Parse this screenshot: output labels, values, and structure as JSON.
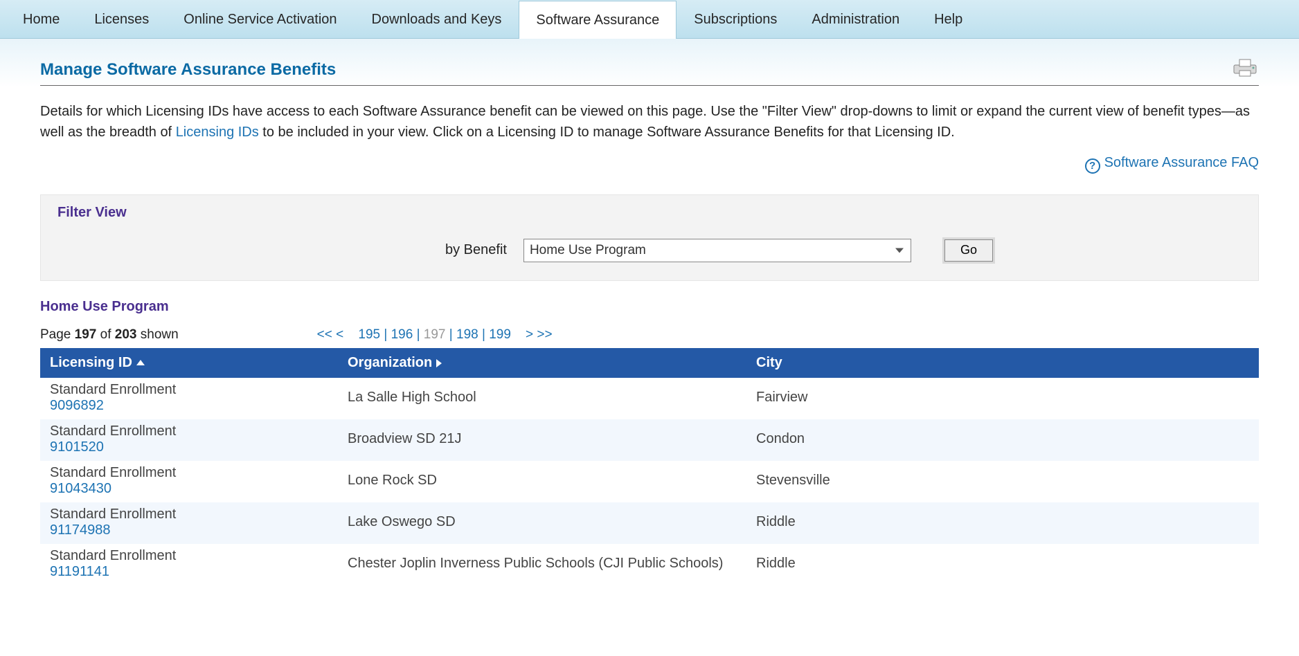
{
  "tabs": [
    {
      "label": "Home"
    },
    {
      "label": "Licenses"
    },
    {
      "label": "Online Service Activation"
    },
    {
      "label": "Downloads and Keys"
    },
    {
      "label": "Software Assurance",
      "active": true
    },
    {
      "label": "Subscriptions"
    },
    {
      "label": "Administration"
    },
    {
      "label": "Help"
    }
  ],
  "header": {
    "title": "Manage Software Assurance Benefits"
  },
  "intro": {
    "pre": "Details for which Licensing IDs have access to each Software Assurance benefit can be viewed on this page. Use the \"Filter View\" drop-downs to limit or expand the current view of benefit types—as well as the breadth of ",
    "link": "Licensing IDs",
    "post": " to be included in your view. Click on a Licensing ID to manage Software Assurance Benefits for that Licensing ID."
  },
  "faq": {
    "label": "Software Assurance FAQ"
  },
  "filter": {
    "section_label": "Filter View",
    "by_label": "by Benefit",
    "selected": "Home Use Program",
    "go_label": "Go"
  },
  "section": {
    "title": "Home Use Program"
  },
  "pager": {
    "prefix": "Page ",
    "current": "197",
    "of": " of ",
    "total": "203",
    "suffix": " shown",
    "first": "<<",
    "prev": "<",
    "pages": [
      "195",
      "196",
      "197",
      "198",
      "199"
    ],
    "next": ">",
    "last": ">>"
  },
  "table": {
    "headers": {
      "licensing": "Licensing ID",
      "org": "Organization",
      "city": "City"
    },
    "rows": [
      {
        "type": "Standard Enrollment",
        "id": "9096892",
        "org": "La Salle High School",
        "city": "Fairview"
      },
      {
        "type": "Standard Enrollment",
        "id": "9101520",
        "org": "Broadview SD 21J",
        "city": "Condon"
      },
      {
        "type": "Standard Enrollment",
        "id": "91043430",
        "org": "Lone Rock SD",
        "city": "Stevensville"
      },
      {
        "type": "Standard Enrollment",
        "id": "91174988",
        "org": "Lake Oswego SD",
        "city": "Riddle"
      },
      {
        "type": "Standard Enrollment",
        "id": "91191141",
        "org": "Chester Joplin Inverness Public Schools (CJI Public Schools)",
        "city": "Riddle"
      }
    ]
  }
}
